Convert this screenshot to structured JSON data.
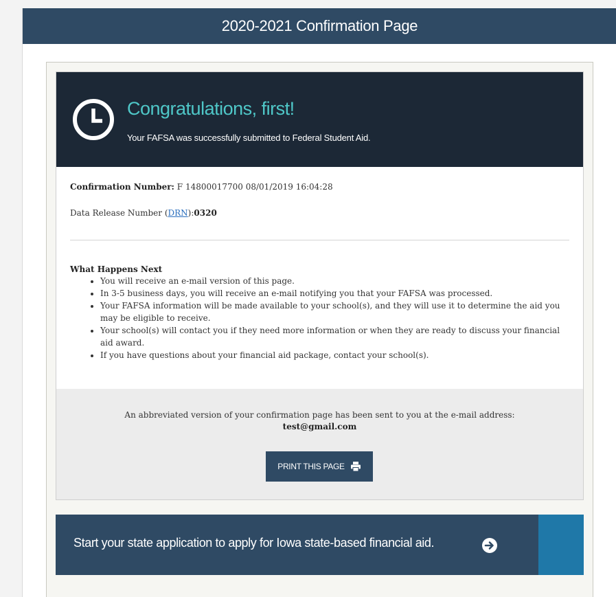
{
  "header": {
    "title": "2020-2021 Confirmation Page"
  },
  "hero": {
    "icon": "clock-icon",
    "title": "Congratulations, first!",
    "subtitle": "Your FAFSA was successfully submitted to Federal Student Aid."
  },
  "confirmation": {
    "label": "Confirmation Number:",
    "value": " F 14800017700 08/01/2019 16:04:28"
  },
  "drn": {
    "label_before": "Data Release Number (",
    "link": "DRN",
    "label_after": "):",
    "value": "0320"
  },
  "next": {
    "title": "What Happens Next",
    "items": [
      "You will receive an e-mail version of this page.",
      "In 3-5 business days, you will receive an e-mail notifying you that your FAFSA was processed.",
      "Your FAFSA information will be made available to your school(s), and they will use it to determine the aid you may be eligible to receive.",
      "Your school(s) will contact you if they need more information or when they are ready to discuss your financial aid award.",
      "If you have questions about your financial aid package, contact your school(s)."
    ]
  },
  "email": {
    "message": "An abbreviated version of your confirmation page has been sent to you at the e-mail address:",
    "address": "test@gmail.com"
  },
  "print_button": {
    "label": "PRINT THIS PAGE",
    "icon": "printer-icon"
  },
  "state": {
    "text": "Start your state application to apply for Iowa state-based financial aid.",
    "icon": "arrow-right-circle-icon"
  },
  "colors": {
    "header_bg": "#2f4a64",
    "hero_bg": "#1c2836",
    "hero_title": "#4fc7c8",
    "accent": "#1f78a8",
    "link": "#2a6ebd"
  }
}
